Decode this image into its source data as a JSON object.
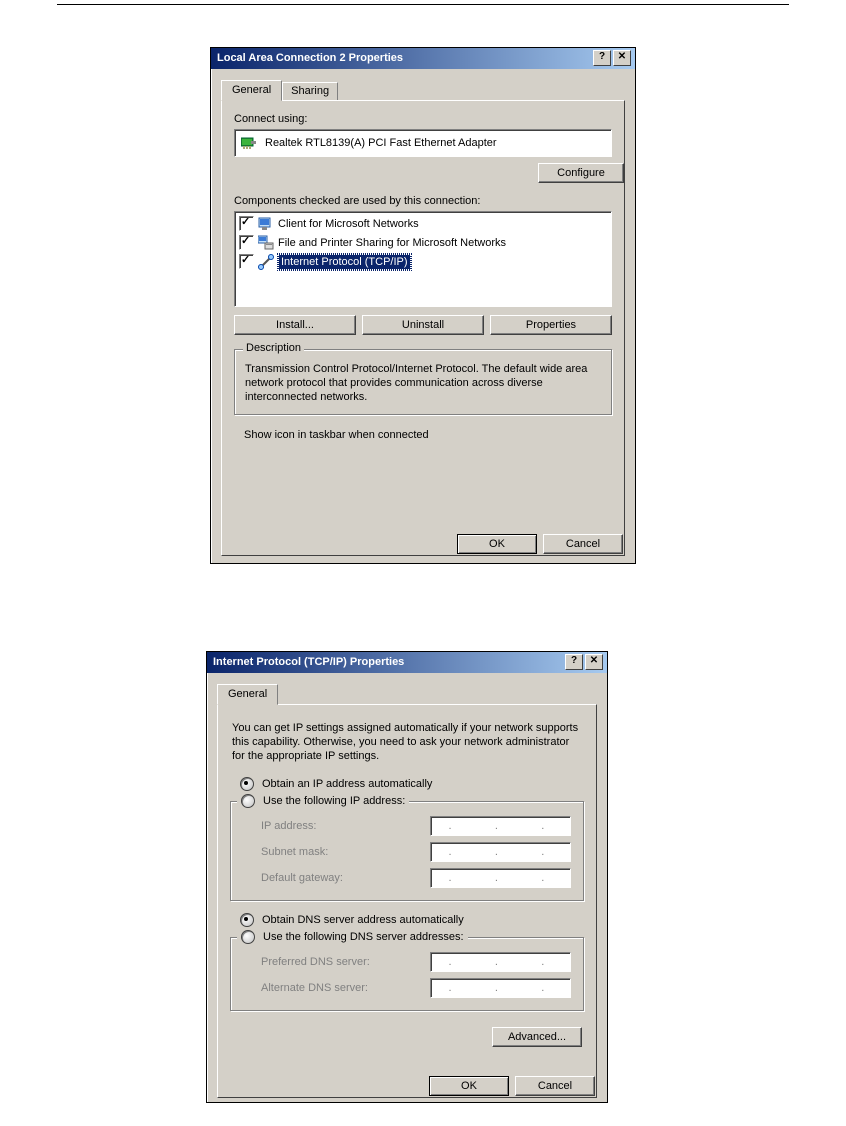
{
  "dialog1": {
    "title": "Local Area Connection 2 Properties",
    "help_char": "?",
    "close_char": "✕",
    "tabs": {
      "general": "General",
      "sharing": "Sharing"
    },
    "connect_using_label": "Connect using:",
    "adapter_name": "Realtek RTL8139(A) PCI Fast Ethernet Adapter",
    "configure_btn": "Configure",
    "components_label": "Components checked are used by this connection:",
    "components": [
      {
        "label": "Client for Microsoft Networks",
        "checked": true,
        "selected": false
      },
      {
        "label": "File and Printer Sharing for Microsoft Networks",
        "checked": true,
        "selected": false
      },
      {
        "label": "Internet Protocol (TCP/IP)",
        "checked": true,
        "selected": true
      }
    ],
    "install_btn": "Install...",
    "uninstall_btn": "Uninstall",
    "properties_btn": "Properties",
    "description_legend": "Description",
    "description_text": "Transmission Control Protocol/Internet Protocol. The default wide area network protocol that provides communication across diverse interconnected networks.",
    "show_icon_label": "Show icon in taskbar when connected",
    "ok_btn": "OK",
    "cancel_btn": "Cancel"
  },
  "dialog2": {
    "title": "Internet Protocol (TCP/IP) Properties",
    "help_char": "?",
    "close_char": "✕",
    "tab_general": "General",
    "info_text": "You can get IP settings assigned automatically if your network supports this capability. Otherwise, you need to ask your network administrator for the appropriate IP settings.",
    "obtain_ip": "Obtain an IP address automatically",
    "use_ip": "Use the following IP address:",
    "ip_address_label": "IP address:",
    "subnet_label": "Subnet mask:",
    "gateway_label": "Default gateway:",
    "obtain_dns": "Obtain DNS server address automatically",
    "use_dns": "Use the following DNS server addresses:",
    "pref_dns_label": "Preferred DNS server:",
    "alt_dns_label": "Alternate DNS server:",
    "ip_placeholder": "...",
    "advanced_btn": "Advanced...",
    "ok_btn": "OK",
    "cancel_btn": "Cancel"
  }
}
